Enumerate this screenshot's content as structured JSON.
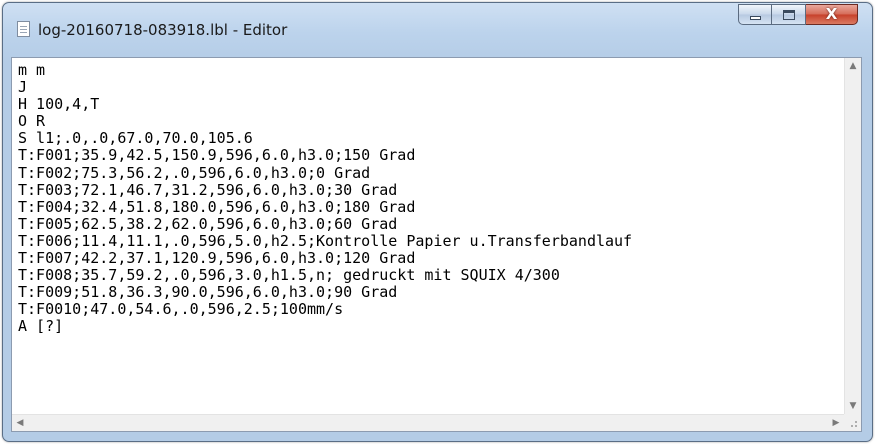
{
  "window": {
    "title": "log-20160718-083918.lbl - Editor",
    "icon": "notepad-icon",
    "controls": {
      "minimize_icon": "minimize-icon",
      "maximize_icon": "maximize-icon",
      "close_icon": "close-icon",
      "close_glyph": "X",
      "close_color": "#c7402a"
    }
  },
  "editor": {
    "lines": [
      "m m",
      "J",
      "H 100,4,T",
      "O R",
      "S l1;.0,.0,67.0,70.0,105.6",
      "T:F001;35.9,42.5,150.9,596,6.0,h3.0;150 Grad",
      "T:F002;75.3,56.2,.0,596,6.0,h3.0;0 Grad",
      "T:F003;72.1,46.7,31.2,596,6.0,h3.0;30 Grad",
      "T:F004;32.4,51.8,180.0,596,6.0,h3.0;180 Grad",
      "T:F005;62.5,38.2,62.0,596,6.0,h3.0;60 Grad",
      "T:F006;11.4,11.1,.0,596,5.0,h2.5;Kontrolle Papier u.Transferbandlauf",
      "T:F007;42.2,37.1,120.9,596,6.0,h3.0;120 Grad",
      "T:F008;35.7,59.2,.0,596,3.0,h1.5,n; gedruckt mit SQUIX 4/300",
      "T:F009;51.8,36.3,90.0,596,6.0,h3.0;90 Grad",
      "T:F0010;47.0,54.6,.0,596,2.5;100mm/s",
      "A [?]"
    ]
  },
  "scrollbars": {
    "up_arrow": "▲",
    "down_arrow": "▼",
    "left_arrow": "◀",
    "right_arrow": "▶"
  }
}
